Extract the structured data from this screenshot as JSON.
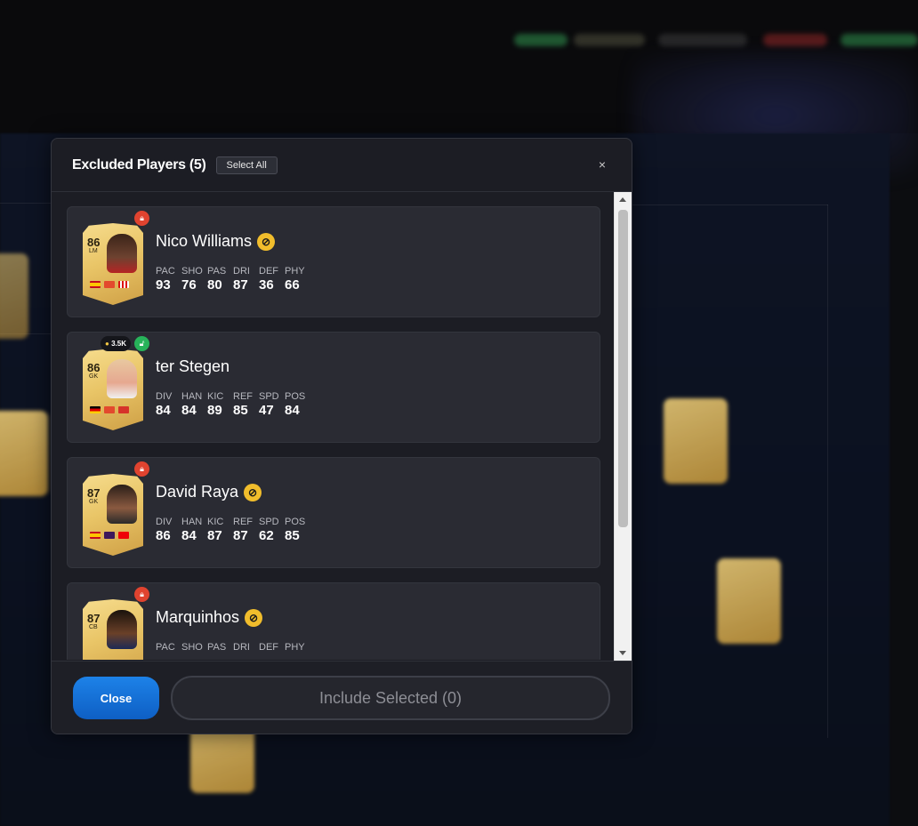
{
  "modal": {
    "title": "Excluded Players (5)",
    "select_all_label": "Select All",
    "close_icon": "×",
    "footer": {
      "close_label": "Close",
      "include_label": "Include Selected (0)"
    }
  },
  "players": [
    {
      "name": "Nico Williams",
      "rating": "86",
      "position": "LM",
      "lock_color": "#e0432f",
      "untradeable": true,
      "stat_labels": [
        "PAC",
        "SHO",
        "PAS",
        "DRI",
        "DEF",
        "PHY"
      ],
      "stat_values": [
        "93",
        "76",
        "80",
        "87",
        "36",
        "66"
      ]
    },
    {
      "name": "ter Stegen",
      "rating": "86",
      "position": "GK",
      "lock_color": "#27b35a",
      "price": "3.5K",
      "untradeable": false,
      "stat_labels": [
        "DIV",
        "HAN",
        "KIC",
        "REF",
        "SPD",
        "POS"
      ],
      "stat_values": [
        "84",
        "84",
        "89",
        "85",
        "47",
        "84"
      ]
    },
    {
      "name": "David Raya",
      "rating": "87",
      "position": "GK",
      "lock_color": "#e0432f",
      "untradeable": true,
      "stat_labels": [
        "DIV",
        "HAN",
        "KIC",
        "REF",
        "SPD",
        "POS"
      ],
      "stat_values": [
        "86",
        "84",
        "87",
        "87",
        "62",
        "85"
      ]
    },
    {
      "name": "Marquinhos",
      "rating": "87",
      "position": "CB",
      "lock_color": "#e0432f",
      "untradeable": true,
      "stat_labels": [
        "PAC",
        "SHO",
        "PAS",
        "DRI",
        "DEF",
        "PHY"
      ],
      "stat_values": [
        "",
        "",
        "",
        "",
        "",
        ""
      ]
    }
  ],
  "colors": {
    "primary_button": "#1d82e8",
    "card_gold": "#e9c567",
    "untradeable": "#f1bd2c"
  }
}
